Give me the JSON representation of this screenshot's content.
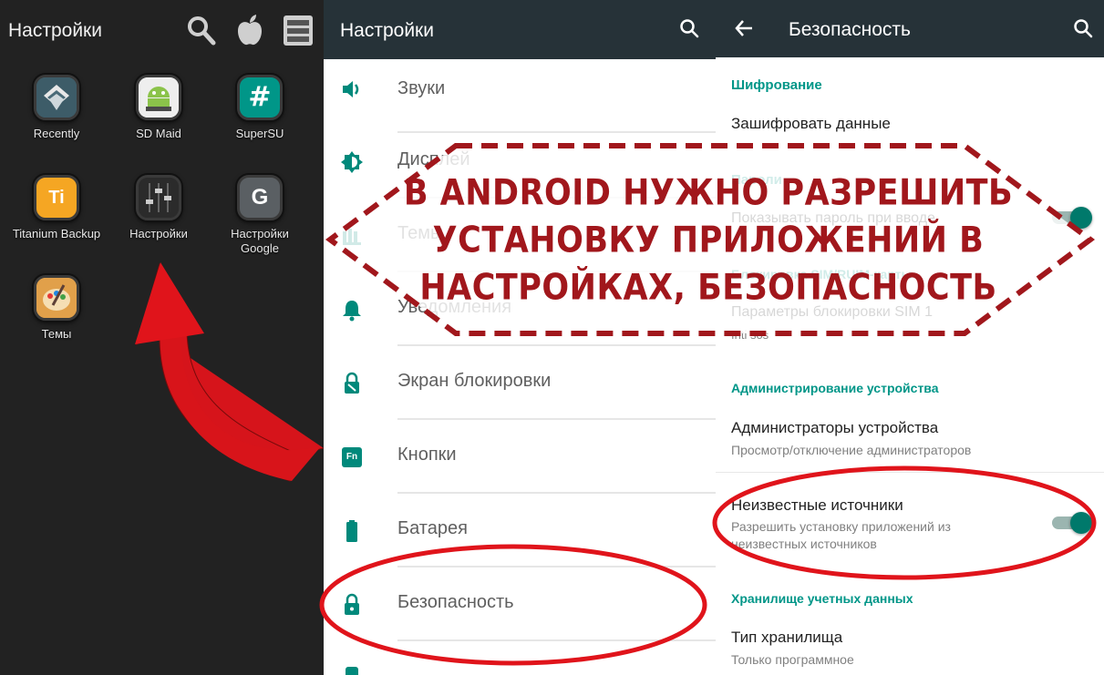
{
  "launcher": {
    "title": "Настройки",
    "header_icons": [
      "search-icon",
      "apple-icon",
      "server-icon"
    ],
    "apps": [
      {
        "label": "Recently",
        "icon": "recently-icon"
      },
      {
        "label": "SD Maid",
        "icon": "sd-maid-icon"
      },
      {
        "label": "SuperSU",
        "icon": "supersu-icon"
      },
      {
        "label": "Titanium Backup",
        "icon": "titanium-backup-icon",
        "glyph": "Ti"
      },
      {
        "label": "Настройки",
        "icon": "settings-icon"
      },
      {
        "label": "Настройки Google",
        "icon": "google-settings-icon",
        "glyph": "G"
      },
      {
        "label": "Темы",
        "icon": "themes-icon"
      }
    ],
    "supersu_glyph": "#"
  },
  "settings": {
    "title": "Настройки",
    "items": [
      {
        "label": "Звуки",
        "icon": "volume-icon"
      },
      {
        "label": "Дисплей",
        "icon": "brightness-icon"
      },
      {
        "label": "Темы",
        "icon": "themes-icon"
      },
      {
        "label": "Уведомления",
        "icon": "bell-icon"
      },
      {
        "label": "Экран блокировки",
        "icon": "lock-screen-icon"
      },
      {
        "label": "Кнопки",
        "icon": "fn-key-icon",
        "glyph": "Fn"
      },
      {
        "label": "Батарея",
        "icon": "battery-icon"
      },
      {
        "label": "Безопасность",
        "icon": "lock-icon"
      }
    ]
  },
  "security": {
    "title": "Безопасность",
    "sections": {
      "encryption": "Шифрование",
      "passwords": "Пароли",
      "sim_lock": "Блокировка SIM/RUIM-карты",
      "device_admin": "Администрирование устройства",
      "credential_storage": "Хранилище учетных данных"
    },
    "items": {
      "encrypt_data": "Зашифровать данные",
      "show_password": "Показывать пароль при вводе",
      "sim_lock_params": "Параметры блокировки SIM 1",
      "sim_lock_params_summary": "Inti sos",
      "device_admins": "Администраторы устройства",
      "device_admins_summary": "Просмотр/отключение администраторов",
      "unknown_sources": "Неизвестные источники",
      "unknown_sources_summary": "Разрешить установку приложений из неизвестных источников",
      "storage_type": "Тип хранилища",
      "storage_type_summary": "Только программное"
    },
    "toggles": {
      "show_password": true,
      "unknown_sources": true
    }
  },
  "banner": {
    "lines": [
      "В ANDROID НУЖНО РАЗРЕШИТЬ",
      "УСТАНОВКУ ПРИЛОЖЕНИЙ В",
      "НАСТРОЙКАХ, БЕЗОПАСНОСТЬ"
    ]
  },
  "colors": {
    "accent": "#009688",
    "toolbar": "#263238",
    "annotation_red": "#a1171c",
    "circle_red": "#e0141b"
  }
}
